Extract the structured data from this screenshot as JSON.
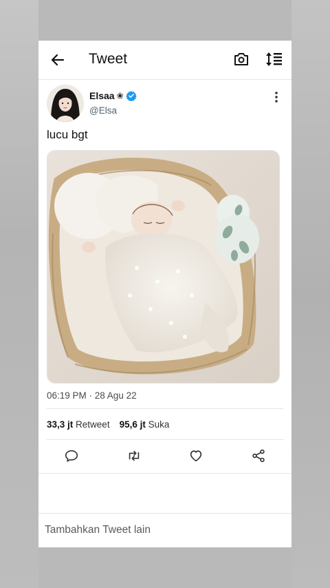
{
  "header": {
    "back_icon": "arrow-left-icon",
    "title": "Tweet",
    "camera_icon": "camera-icon",
    "sort_icon": "sort-lines-icon"
  },
  "tweet": {
    "author": {
      "display_name": "Elsaa",
      "name_glyph": "❀",
      "handle": "@Elsa",
      "verified": true
    },
    "text": "lucu bgt",
    "media_description": "baby-in-basket-photo",
    "timestamp": "06:19 PM · 28 Agu 22",
    "stats": {
      "retweets_count": "33,3 jt",
      "retweets_label": "Retweet",
      "likes_count": "95,6 jt",
      "likes_label": "Suka"
    }
  },
  "actions": [
    "reply-icon",
    "retweet-icon",
    "like-icon",
    "share-icon"
  ],
  "footer": {
    "add_tweet": "Tambahkan Tweet lain"
  },
  "colors": {
    "verified": "#1d9bf0",
    "text": "#111111",
    "secondary": "#536471",
    "backdrop": "#b9b9b9"
  }
}
